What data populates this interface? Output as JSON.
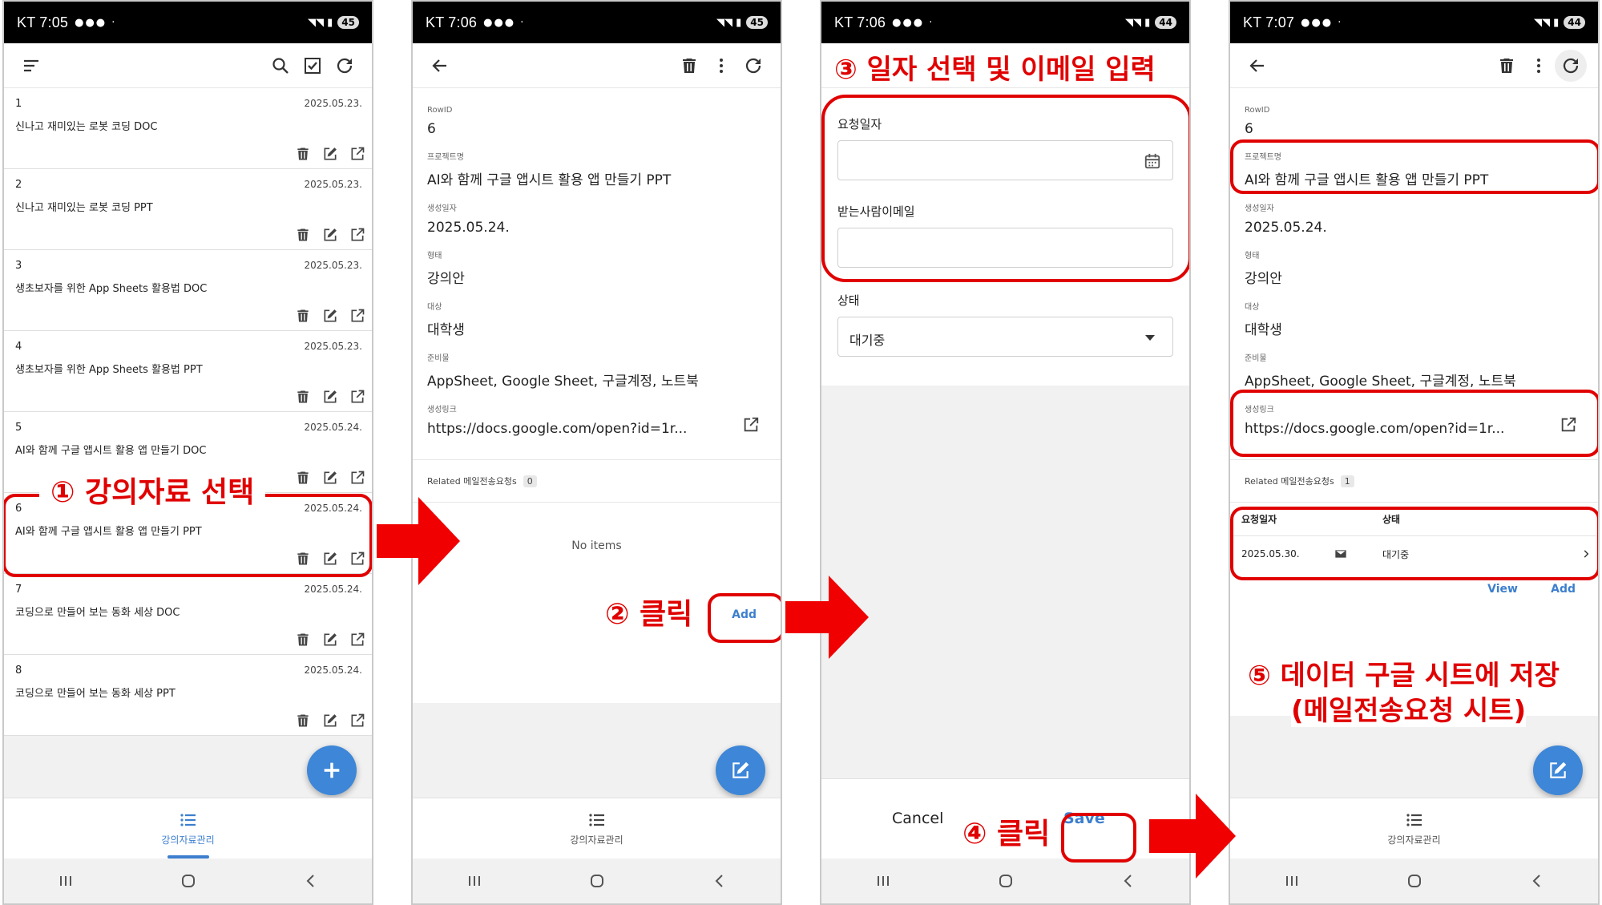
{
  "status": {
    "p1_time": "KT 7:05",
    "p2_time": "KT 7:06",
    "p3_time": "KT 7:06",
    "p4_time": "KT 7:07",
    "p1_battery": "45",
    "p2_battery": "45",
    "p3_battery": "44",
    "p4_battery": "44"
  },
  "list": {
    "items": [
      {
        "id": "1",
        "date": "2025.05.23.",
        "title": "신나고 재미있는 로봇 코딩 DOC"
      },
      {
        "id": "2",
        "date": "2025.05.23.",
        "title": "신나고 재미있는 로봇 코딩 PPT"
      },
      {
        "id": "3",
        "date": "2025.05.23.",
        "title": "생초보자를 위한 App Sheets 활용법 DOC"
      },
      {
        "id": "4",
        "date": "2025.05.23.",
        "title": "생초보자를 위한 App Sheets 활용법 PPT"
      },
      {
        "id": "5",
        "date": "2025.05.24.",
        "title": "AI와 함께 구글 앱시트 활용 앱 만들기 DOC"
      },
      {
        "id": "6",
        "date": "2025.05.24.",
        "title": "AI와 함께 구글 앱시트 활용 앱 만들기 PPT"
      },
      {
        "id": "7",
        "date": "2025.05.24.",
        "title": "코딩으로 만들어 보는 동화 세상 DOC"
      },
      {
        "id": "8",
        "date": "2025.05.24.",
        "title": "코딩으로 만들어 보는 동화 세상 PPT"
      }
    ]
  },
  "nav": {
    "label": "강의자료관리"
  },
  "detail": {
    "rowid_label": "RowID",
    "rowid": "6",
    "project_label": "프로젝트명",
    "project": "AI와 함께 구글 앱시트 활용 앱 만들기 PPT",
    "created_label": "생성일자",
    "created": "2025.05.24.",
    "type_label": "형태",
    "type": "강의안",
    "target_label": "대상",
    "target": "대학생",
    "prep_label": "준비물",
    "prep": "AppSheet, Google Sheet, 구글계정, 노트북",
    "link_label": "생성링크",
    "link": "https://docs.google.com/open?id=1r...",
    "related_label": "Related 메일전송요청s",
    "related_count_p2": "0",
    "related_count_p4": "1",
    "no_items": "No items",
    "add": "Add",
    "view": "View"
  },
  "form": {
    "date_label": "요청일자",
    "date_value": "",
    "email_label": "받는사람이메일",
    "email_value": "",
    "status_label": "상태",
    "status_value": "대기중",
    "cancel": "Cancel",
    "save": "Save"
  },
  "table": {
    "col_date": "요청일자",
    "col_status": "상태",
    "row_date": "2025.05.30.",
    "row_status": "대기중"
  },
  "annotations": {
    "a1": "① 강의자료 선택",
    "a2": "② 클릭",
    "a3": "③ 일자 선택 및 이메일 입력",
    "a4": "④ 클릭",
    "a5_line1": "⑤ 데이터 구글 시트에 저장",
    "a5_line2": "(메일전송요청 시트)"
  },
  "colors": {
    "accent": "#3d7fce",
    "annotation": "#e00000",
    "fab": "#3d86d8"
  }
}
